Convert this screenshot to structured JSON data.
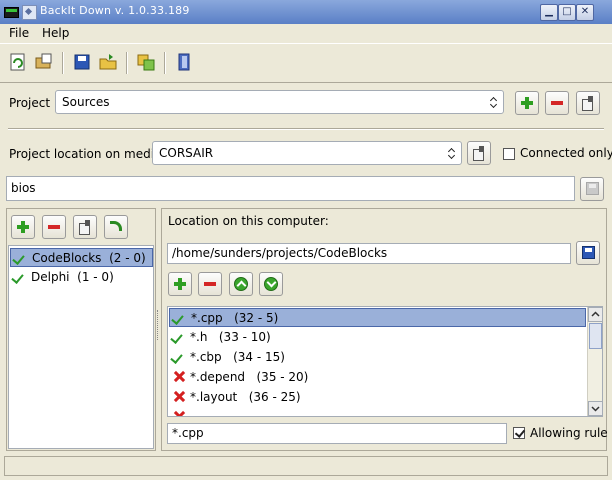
{
  "window": {
    "title": "BackIt Down v. 1.0.33.189",
    "min": "▁",
    "max": "□",
    "close": "✕"
  },
  "menu": {
    "file": "File",
    "help": "Help"
  },
  "project": {
    "label": "Project",
    "selected": "Sources"
  },
  "media": {
    "label": "Project location on media:",
    "selected": "CORSAIR",
    "connected_only": "Connected only"
  },
  "folder": {
    "value": "bios"
  },
  "left_list": {
    "items": [
      {
        "label": "CodeBlocks",
        "counts": "(2 - 0)"
      },
      {
        "label": "Delphi",
        "counts": "(1 - 0)"
      }
    ]
  },
  "location": {
    "label": "Location on this computer:",
    "path": "/home/sunders/projects/CodeBlocks"
  },
  "rules": {
    "items": [
      {
        "label": "*.cpp",
        "counts": "(32 - 5)",
        "allow": true
      },
      {
        "label": "*.h",
        "counts": "(33 - 10)",
        "allow": true
      },
      {
        "label": "*.cbp",
        "counts": "(34 - 15)",
        "allow": true
      },
      {
        "label": "*.depend",
        "counts": "(35 - 20)",
        "allow": false
      },
      {
        "label": "*.layout",
        "counts": "(36 - 25)",
        "allow": false
      }
    ],
    "edit_value": "*.cpp",
    "allowing_label": "Allowing rule"
  }
}
